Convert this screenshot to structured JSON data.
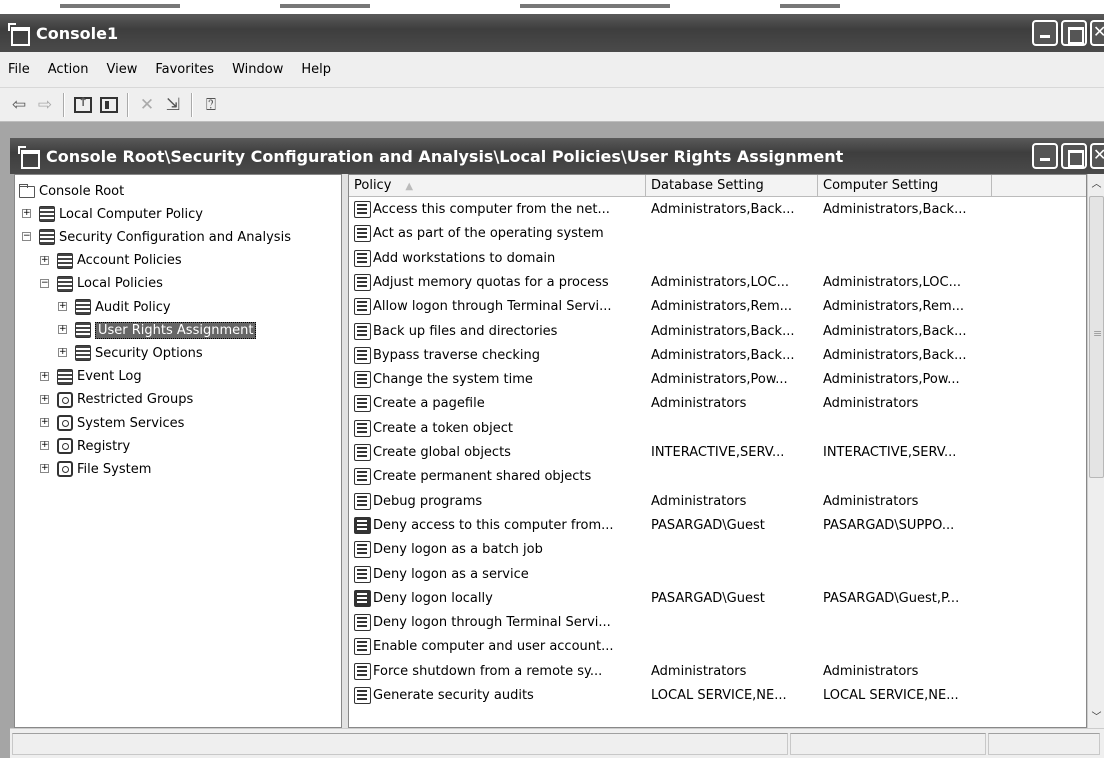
{
  "outer_window": {
    "title": "Console1"
  },
  "menu": [
    "File",
    "Action",
    "View",
    "Favorites",
    "Window",
    "Help"
  ],
  "toolbar": {
    "icons": [
      "back-arrow-icon",
      "forward-arrow-icon",
      "up-folder-icon",
      "show-hide-tree-icon",
      "delete-icon",
      "export-list-icon",
      "help-icon"
    ]
  },
  "inner_window": {
    "title": "Console Root\\Security Configuration and Analysis\\Local Policies\\User Rights Assignment"
  },
  "tree": [
    {
      "label": "Console Root",
      "icon": "folder-icon",
      "level": 0,
      "expander": ""
    },
    {
      "label": "Local Computer Policy",
      "icon": "computer-policy-icon",
      "level": 1,
      "expander": "+"
    },
    {
      "label": "Security Configuration and Analysis",
      "icon": "security-config-icon",
      "level": 1,
      "expander": "-"
    },
    {
      "label": "Account Policies",
      "icon": "policy-icon",
      "level": 2,
      "expander": "+"
    },
    {
      "label": "Local Policies",
      "icon": "policy-icon",
      "level": 2,
      "expander": "-"
    },
    {
      "label": "Audit Policy",
      "icon": "policy-icon",
      "level": 3,
      "expander": "+"
    },
    {
      "label": "User Rights Assignment",
      "icon": "policy-icon",
      "level": 3,
      "expander": "+",
      "selected": true
    },
    {
      "label": "Security Options",
      "icon": "policy-icon",
      "level": 3,
      "expander": "+"
    },
    {
      "label": "Event Log",
      "icon": "policy-icon",
      "level": 2,
      "expander": "+"
    },
    {
      "label": "Restricted Groups",
      "icon": "safe-icon",
      "level": 2,
      "expander": "+"
    },
    {
      "label": "System Services",
      "icon": "safe-icon",
      "level": 2,
      "expander": "+"
    },
    {
      "label": "Registry",
      "icon": "safe-icon",
      "level": 2,
      "expander": "+"
    },
    {
      "label": "File System",
      "icon": "safe-icon",
      "level": 2,
      "expander": "+"
    }
  ],
  "list": {
    "columns": [
      "Policy",
      "Database Setting",
      "Computer Setting",
      ""
    ],
    "sort_indicator": "▲",
    "rows": [
      {
        "policy": "Access this computer from the net...",
        "db": "Administrators,Back...",
        "computer": "Administrators,Back...",
        "icon": "policy-ok-icon"
      },
      {
        "policy": "Act as part of the operating system",
        "db": "",
        "computer": "",
        "icon": "policy-ok-icon"
      },
      {
        "policy": "Add workstations to domain",
        "db": "",
        "computer": "",
        "icon": "policy-ok-icon"
      },
      {
        "policy": "Adjust memory quotas for a process",
        "db": "Administrators,LOC...",
        "computer": "Administrators,LOC...",
        "icon": "policy-ok-icon"
      },
      {
        "policy": "Allow logon through Terminal Servi...",
        "db": "Administrators,Rem...",
        "computer": "Administrators,Rem...",
        "icon": "policy-ok-icon"
      },
      {
        "policy": "Back up files and directories",
        "db": "Administrators,Back...",
        "computer": "Administrators,Back...",
        "icon": "policy-ok-icon"
      },
      {
        "policy": "Bypass traverse checking",
        "db": "Administrators,Back...",
        "computer": "Administrators,Back...",
        "icon": "policy-ok-icon"
      },
      {
        "policy": "Change the system time",
        "db": "Administrators,Pow...",
        "computer": "Administrators,Pow...",
        "icon": "policy-ok-icon"
      },
      {
        "policy": "Create a pagefile",
        "db": "Administrators",
        "computer": "Administrators",
        "icon": "policy-ok-icon"
      },
      {
        "policy": "Create a token object",
        "db": "",
        "computer": "",
        "icon": "policy-ok-icon"
      },
      {
        "policy": "Create global objects",
        "db": "INTERACTIVE,SERV...",
        "computer": "INTERACTIVE,SERV...",
        "icon": "policy-ok-icon"
      },
      {
        "policy": "Create permanent shared objects",
        "db": "",
        "computer": "",
        "icon": "policy-ok-icon"
      },
      {
        "policy": "Debug programs",
        "db": "Administrators",
        "computer": "Administrators",
        "icon": "policy-ok-icon"
      },
      {
        "policy": "Deny access to this computer from...",
        "db": "PASARGAD\\Guest",
        "computer": "PASARGAD\\SUPPO...",
        "icon": "policy-mismatch-icon"
      },
      {
        "policy": "Deny logon as a batch job",
        "db": "",
        "computer": "",
        "icon": "policy-ok-icon"
      },
      {
        "policy": "Deny logon as a service",
        "db": "",
        "computer": "",
        "icon": "policy-ok-icon"
      },
      {
        "policy": "Deny logon locally",
        "db": "PASARGAD\\Guest",
        "computer": "PASARGAD\\Guest,P...",
        "icon": "policy-mismatch-icon"
      },
      {
        "policy": "Deny logon through Terminal Servi...",
        "db": "",
        "computer": "",
        "icon": "policy-ok-icon"
      },
      {
        "policy": "Enable computer and user account...",
        "db": "",
        "computer": "",
        "icon": "policy-ok-icon"
      },
      {
        "policy": "Force shutdown from a remote sy...",
        "db": "Administrators",
        "computer": "Administrators",
        "icon": "policy-ok-icon"
      },
      {
        "policy": "Generate security audits",
        "db": "LOCAL SERVICE,NE...",
        "computer": "LOCAL SERVICE,NE...",
        "icon": "policy-ok-icon"
      }
    ]
  },
  "statusbar": {
    "text": ""
  }
}
